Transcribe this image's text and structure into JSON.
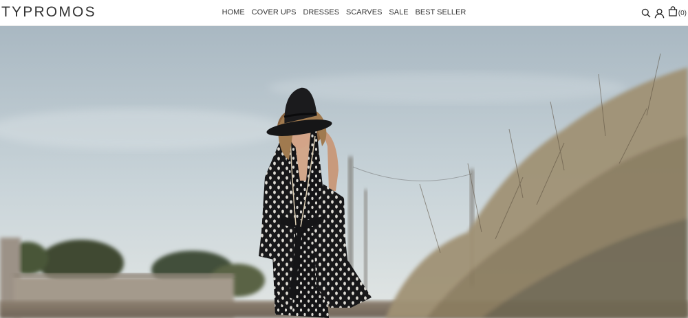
{
  "brand": {
    "name": "TYPROMOS"
  },
  "nav": {
    "items": [
      {
        "label": "HOME"
      },
      {
        "label": "COVER UPS"
      },
      {
        "label": "DRESSES"
      },
      {
        "label": "SCARVES"
      },
      {
        "label": "SALE"
      },
      {
        "label": "BEST SELLER"
      }
    ]
  },
  "header_icons": {
    "search": "search-icon",
    "account": "user-icon",
    "cart": "shopping-bag-icon",
    "cart_count": "(0)"
  },
  "colors": {
    "text": "#333333",
    "sky_top": "#aab8c1",
    "sky_bottom": "#dfe6e8",
    "dress": "#151517"
  }
}
